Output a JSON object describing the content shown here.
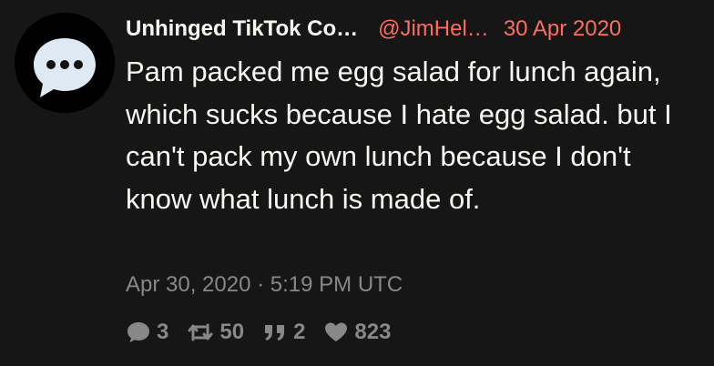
{
  "tweet": {
    "fullname": "Unhinged TikTok Co…",
    "username": "@JimHel…",
    "date": "30 Apr 2020",
    "content": "Pam packed me egg salad for lunch again, which sucks because I hate egg salad. but I can't pack my own lunch because I don't know what lunch is made of.",
    "published": "Apr 30, 2020 · 5:19 PM UTC",
    "stats": {
      "replies": "3",
      "retweets": "50",
      "quotes": "2",
      "likes": "823"
    },
    "icons": {
      "avatar": "speech-bubble-ellipsis-icon",
      "replies": "comment-icon",
      "retweets": "retweet-icon",
      "quotes": "quote-icon",
      "likes": "heart-icon"
    }
  },
  "colors": {
    "background": "#161616",
    "text": "#f8f8f2",
    "accent": "#ff6c60",
    "muted": "#888889",
    "avatar_bg": "#000000",
    "avatar_bubble": "#ddeaf4",
    "avatar_dots": "#111111"
  }
}
